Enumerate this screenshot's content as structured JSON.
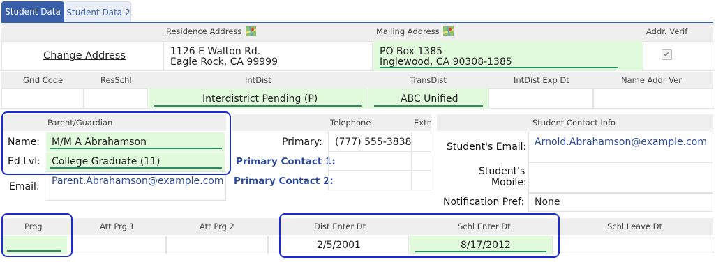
{
  "tabs": [
    {
      "label": "Student Data 1",
      "active": true
    },
    {
      "label": "Student Data 2",
      "active": false
    }
  ],
  "address_section": {
    "residence_header": "Residence Address",
    "mailing_header": "Mailing Address",
    "addr_verif_header": "Addr. Verif",
    "change_address_link": "Change Address",
    "residence_line1": "1126 E Walton Rd.",
    "residence_line2": "Eagle Rock, CA 99999",
    "mailing_line1": "PO Box 1385",
    "mailing_line2": "Inglewood, CA 90308-1385",
    "addr_verified": true
  },
  "grid_section": {
    "headers": {
      "grid_code": "Grid Code",
      "res_schl": "ResSchl",
      "int_dist": "IntDist",
      "trans_dist": "TransDist",
      "int_dist_exp_dt": "IntDist Exp Dt",
      "name_addr_ver": "Name Addr Ver"
    },
    "values": {
      "int_dist": "Interdistrict Pending (P)",
      "trans_dist": "ABC Unified"
    }
  },
  "parent_section": {
    "header": "Parent/Guardian",
    "name_label": "Name:",
    "name_value": "M/M A Abrahamson",
    "edlvl_label": "Ed Lvl:",
    "edlvl_value": "College Graduate (11)",
    "email_label": "Email:",
    "email_value": "Parent.Abrahamson@example.com"
  },
  "telephone_section": {
    "header": "Telephone",
    "extn_header": "Extn",
    "primary_label": "Primary:",
    "primary_value": "(777) 555-3838",
    "primary_contact1_label": "Primary Contact 1:",
    "primary_contact2_label": "Primary Contact 2:"
  },
  "contact_section": {
    "header": "Student Contact Info",
    "email_label": "Student's Email:",
    "email_value": "Arnold.Abrahamson@example.com",
    "mobile_label_line1": "Student's",
    "mobile_label_line2": "Mobile:",
    "notif_label": "Notification Pref:",
    "notif_value": "None"
  },
  "program_section": {
    "headers": {
      "prog": "Prog",
      "att_prg1": "Att Prg 1",
      "att_prg2": "Att Prg 2",
      "dist_enter_dt": "Dist Enter Dt",
      "schl_enter_dt": "Schl Enter Dt",
      "schl_leave_dt": "Schl Leave Dt"
    },
    "values": {
      "dist_enter_dt": "2/5/2001",
      "schl_enter_dt": "8/17/2012"
    }
  },
  "colors": {
    "tab_active": "#3a5fa9",
    "field_highlight": "#e2fadc",
    "field_underline": "#2e8a63",
    "outline": "#1a2cd0",
    "link": "#2c4a95"
  }
}
